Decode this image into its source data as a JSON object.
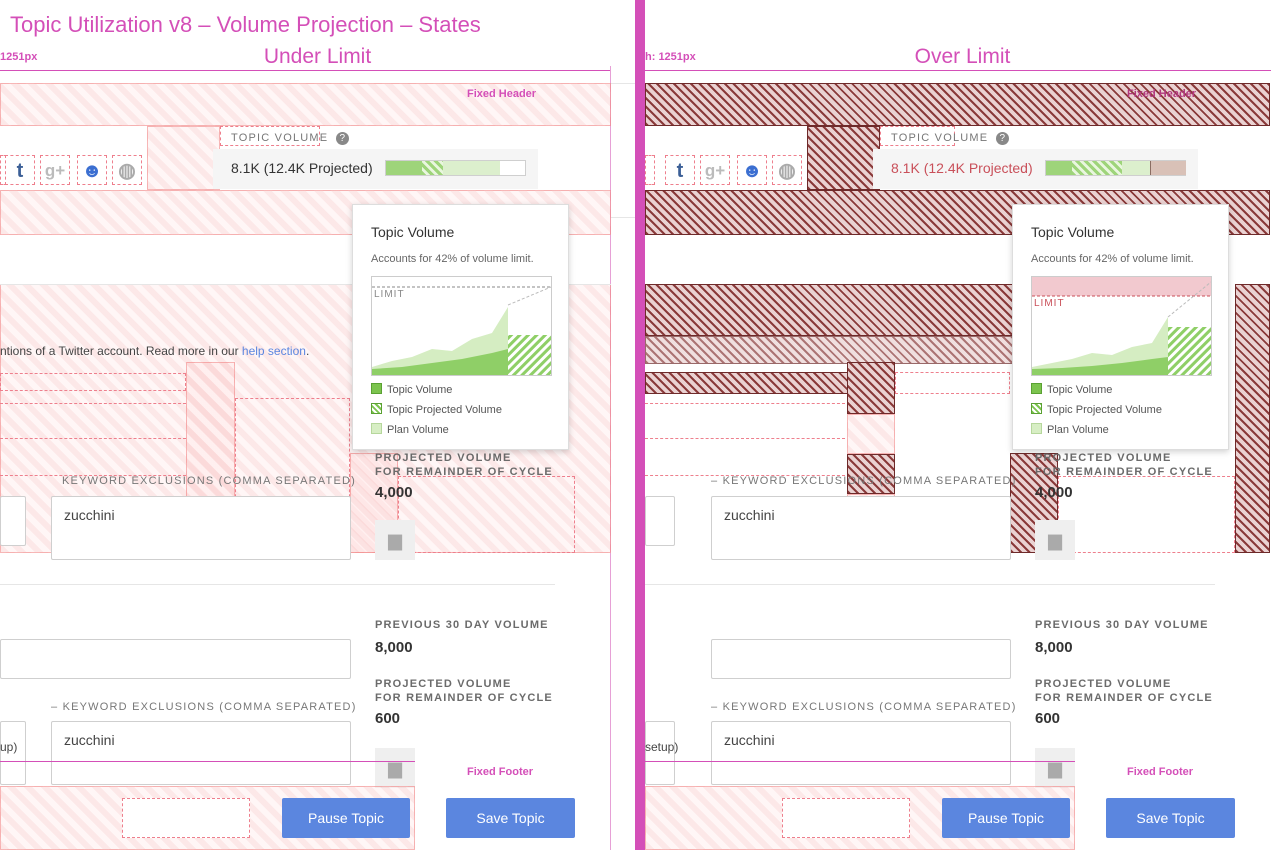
{
  "page_title": "Topic Utilization v8 – Volume Projection – States",
  "width_label": "h: 1251px",
  "colors": {
    "annotation": "#d44fb8",
    "button": "#5b86df",
    "topic_volume": "#7cc44e",
    "over_limit_text": "#c9505a"
  },
  "states": [
    {
      "id": "under",
      "title": "Under Limit",
      "width_label": "1251px",
      "fixed_header_label": "Fixed Header",
      "fixed_footer_label": "Fixed Footer",
      "social_icons": [
        "tumblr-icon",
        "google-plus-icon",
        "reddit-icon",
        "globe-icon"
      ],
      "topic_volume_label": "TOPIC VOLUME",
      "topic_volume_value": "8.1K (12.4K Projected)",
      "bar": {
        "topic_fraction": 0.26,
        "projected_fraction": 0.15,
        "plan_fraction": 0.41,
        "over_fraction": 0
      },
      "popover": {
        "title": "Topic Volume",
        "subtitle": "Accounts for 42% of volume limit.",
        "limit_label": "LIMIT",
        "legend": [
          "Topic Volume",
          "Topic Projected Volume",
          "Plan Volume"
        ]
      },
      "help_text": "ntions of a Twitter account. Read more in our ",
      "help_link": "help section",
      "help_end": ".",
      "rule1": {
        "exclusions_label": "KEYWORD EXCLUSIONS (COMMA SEPARATED)",
        "exclusions_value": "zucchini",
        "projected_label_1": "PROJECTED VOLUME",
        "projected_label_2": "FOR REMAINDER OF CYCLE",
        "projected_value": "4,000"
      },
      "rule2": {
        "prev_label": "PREVIOUS 30 DAY VOLUME",
        "prev_value": "8,000",
        "projected_label_1": "PROJECTED VOLUME",
        "projected_label_2": "FOR REMAINDER OF CYCLE",
        "projected_value": "600",
        "exclusions_label": "– KEYWORD EXCLUSIONS (COMMA SEPARATED)",
        "exclusions_value": "zucchini",
        "left_hint": "up)"
      },
      "pause_button": "Pause Topic",
      "save_button": "Save Topic"
    },
    {
      "id": "over",
      "title": "Over Limit",
      "width_label": "h: 1251px",
      "fixed_header_label": "Fixed Header",
      "fixed_footer_label": "Fixed Footer",
      "social_icons": [
        "tumblr-icon",
        "google-plus-icon",
        "reddit-icon",
        "globe-icon"
      ],
      "topic_volume_label": "TOPIC VOLUME",
      "topic_volume_value": "8.1K (12.4K Projected)",
      "bar": {
        "topic_fraction": 0.19,
        "projected_fraction": 0.36,
        "plan_fraction": 0.2,
        "over_fraction": 0.25
      },
      "popover": {
        "title": "Topic Volume",
        "subtitle": "Accounts for 42% of volume limit.",
        "limit_label": "LIMIT",
        "legend": [
          "Topic Volume",
          "Topic Projected Volume",
          "Plan Volume"
        ]
      },
      "rule1": {
        "exclusions_label": "– KEYWORD EXCLUSIONS (COMMA SEPARATED)",
        "exclusions_value": "zucchini",
        "projected_label_1": "PROJECTED VOLUME",
        "projected_label_2": "FOR REMAINDER OF CYCLE",
        "projected_value": "4,000"
      },
      "rule2": {
        "prev_label": "PREVIOUS 30 DAY VOLUME",
        "prev_value": "8,000",
        "projected_label_1": "PROJECTED VOLUME",
        "projected_label_2": "FOR REMAINDER OF CYCLE",
        "projected_value": "600",
        "exclusions_label": "– KEYWORD EXCLUSIONS (COMMA SEPARATED)",
        "exclusions_value": "zucchini",
        "left_hint": "setup)"
      },
      "pause_button": "Pause Topic",
      "save_button": "Save Topic"
    }
  ]
}
